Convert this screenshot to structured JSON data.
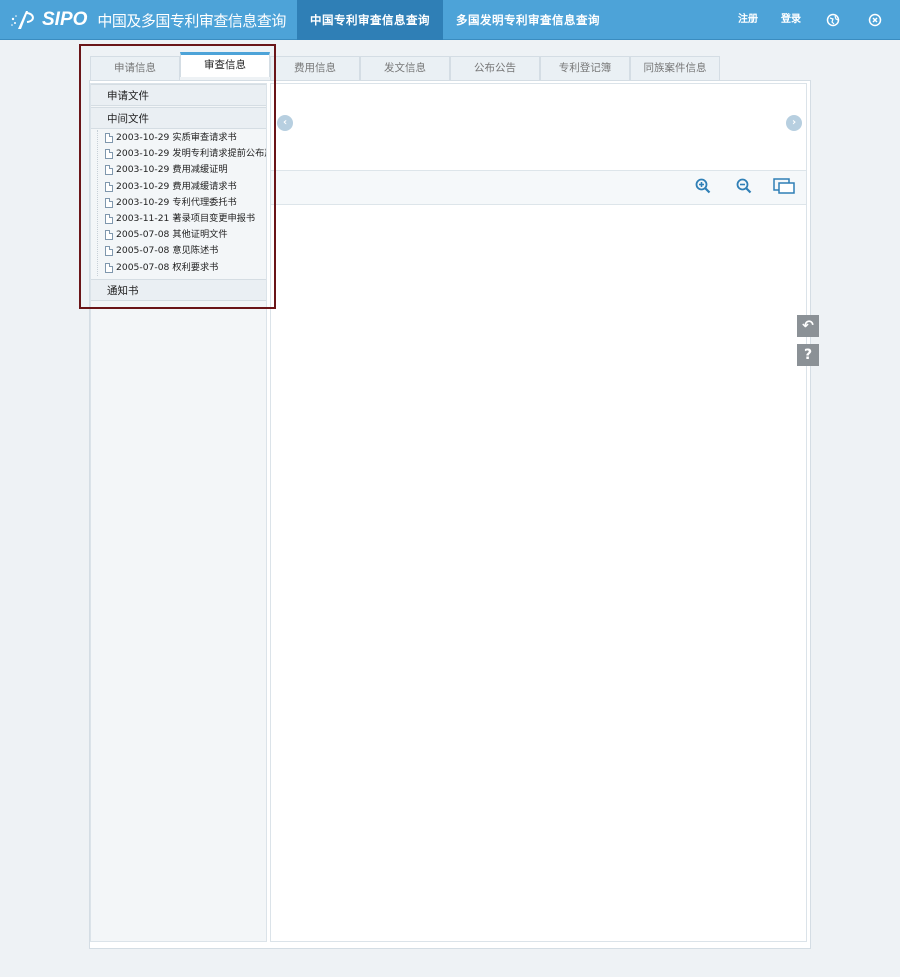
{
  "header": {
    "logo_text": "SIPO",
    "site_title": "中国及多国专利审查信息查询",
    "nav_active": "中国专利审查信息查询",
    "nav_other": "多国发明专利审查信息查询",
    "register": "注册",
    "login": "登录"
  },
  "tabs": [
    {
      "label": "申请信息"
    },
    {
      "label": "审查信息"
    },
    {
      "label": "费用信息"
    },
    {
      "label": "发文信息"
    },
    {
      "label": "公布公告"
    },
    {
      "label": "专利登记簿"
    },
    {
      "label": "同族案件信息"
    }
  ],
  "sidebar": {
    "section_application": "申请文件",
    "section_intermediate": "中间文件",
    "section_notice": "通知书",
    "documents": [
      {
        "date": "2003-10-29",
        "name": "实质审查请求书"
      },
      {
        "date": "2003-10-29",
        "name": "发明专利请求提前公布声明"
      },
      {
        "date": "2003-10-29",
        "name": "费用减缓证明"
      },
      {
        "date": "2003-10-29",
        "name": "费用减缓请求书"
      },
      {
        "date": "2003-10-29",
        "name": "专利代理委托书"
      },
      {
        "date": "2003-11-21",
        "name": "著录项目变更申报书"
      },
      {
        "date": "2005-07-08",
        "name": "其他证明文件"
      },
      {
        "date": "2005-07-08",
        "name": "意见陈述书"
      },
      {
        "date": "2005-07-08",
        "name": "权利要求书"
      }
    ]
  },
  "colors": {
    "header_bg": "#4da3d8",
    "nav_active_bg": "#2f7fb6",
    "highlight_border": "#6a1518"
  }
}
